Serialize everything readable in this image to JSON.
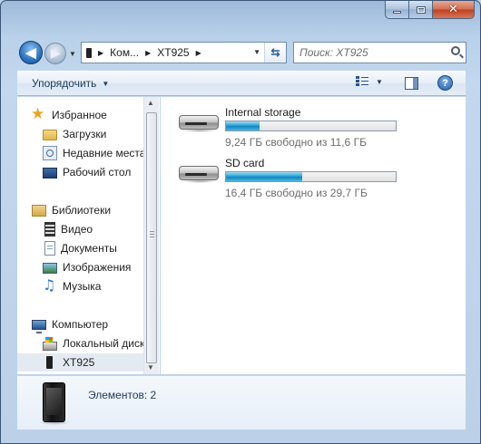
{
  "window": {
    "caption_buttons": [
      "minimize",
      "maximize",
      "close"
    ]
  },
  "navigation": {
    "back_icon": "back-arrow-icon",
    "forward_icon": "forward-arrow-icon",
    "back_glyph": "◀",
    "forward_glyph": "▶"
  },
  "address_bar": {
    "segments": [
      "Ком...",
      "XT925"
    ],
    "separator": "▶"
  },
  "search": {
    "placeholder": "Поиск: XT925"
  },
  "toolbar": {
    "organize_label": "Упорядочить",
    "dropdown_arrow": "▼",
    "help_glyph": "?"
  },
  "sidebar": {
    "sections": [
      {
        "header": {
          "label": "Избранное",
          "icon": "star-icon"
        },
        "items": [
          {
            "label": "Загрузки",
            "icon": "downloads-folder-icon"
          },
          {
            "label": "Недавние места",
            "icon": "recent-places-icon"
          },
          {
            "label": "Рабочий стол",
            "icon": "desktop-icon"
          }
        ]
      },
      {
        "header": {
          "label": "Библиотеки",
          "icon": "libraries-icon"
        },
        "items": [
          {
            "label": "Видео",
            "icon": "video-icon"
          },
          {
            "label": "Документы",
            "icon": "documents-icon"
          },
          {
            "label": "Изображения",
            "icon": "pictures-icon"
          },
          {
            "label": "Музыка",
            "icon": "music-icon"
          }
        ]
      },
      {
        "header": {
          "label": "Компьютер",
          "icon": "computer-icon"
        },
        "items": [
          {
            "label": "Локальный диск",
            "icon": "local-disk-icon"
          },
          {
            "label": "XT925",
            "icon": "phone-icon",
            "selected": true
          }
        ]
      }
    ]
  },
  "drives": [
    {
      "name": "Internal storage",
      "free_text": "9,24 ГБ свободно из 11,6 ГБ",
      "used_fraction": 0.2
    },
    {
      "name": "SD card",
      "free_text": "16,4 ГБ свободно из 29,7 ГБ",
      "used_fraction": 0.45
    }
  ],
  "details": {
    "item_count": "Элементов: 2",
    "icon": "phone-device-icon"
  },
  "colors": {
    "progress_fill": "#2ba2d5",
    "selection": "#e4eaf1"
  }
}
